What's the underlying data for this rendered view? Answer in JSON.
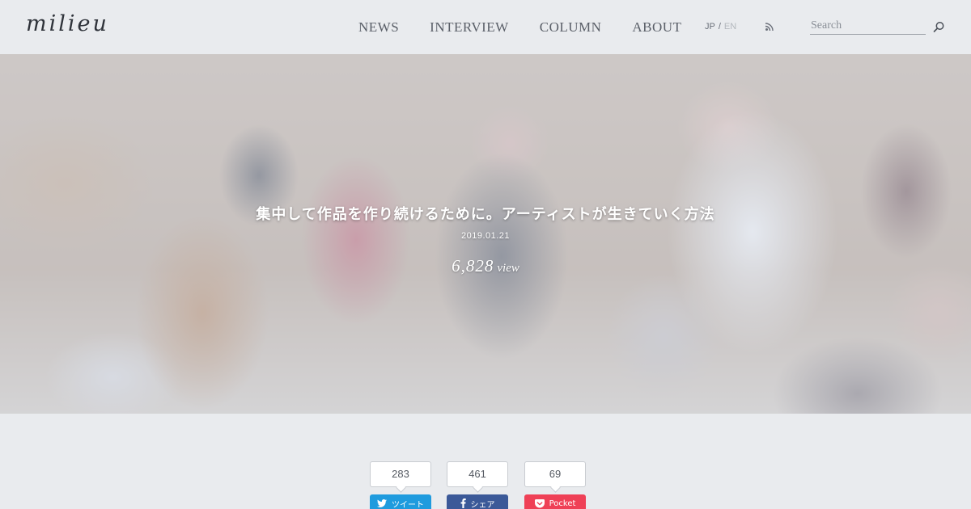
{
  "header": {
    "logo": "milieu",
    "nav": [
      "NEWS",
      "INTERVIEW",
      "COLUMN",
      "ABOUT"
    ],
    "lang": {
      "active": "JP",
      "separator": "/",
      "inactive": "EN"
    },
    "rss_icon": "rss-icon",
    "search": {
      "placeholder": "Search",
      "value": "",
      "icon": "search-icon"
    }
  },
  "hero": {
    "title": "集中して作品を作り続けるために。アーティストが生きていく方法",
    "date": "2019.01.21",
    "views": "6,828",
    "views_unit": "view"
  },
  "share": {
    "twitter": {
      "count": "283",
      "label": "ツイート",
      "icon": "twitter-bird-icon",
      "color": "#1f9bde"
    },
    "facebook": {
      "count": "461",
      "label": "シェア",
      "icon": "facebook-f-icon",
      "color": "#3b5998"
    },
    "pocket": {
      "count": "69",
      "label": "Pocket",
      "icon": "pocket-icon",
      "color": "#ef4056"
    }
  }
}
